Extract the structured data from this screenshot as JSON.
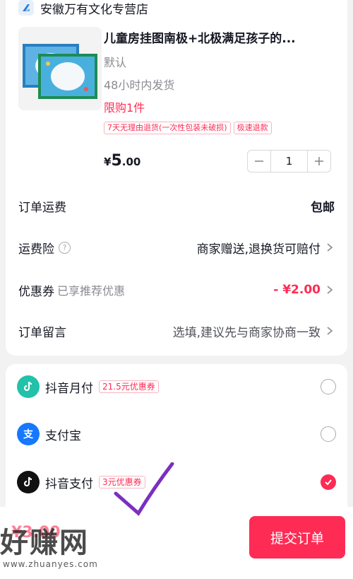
{
  "store": {
    "name": "安徽万有文化专营店",
    "logo_icon": "store-logo-icon"
  },
  "product": {
    "title": "儿童房挂图南极+北极满足孩子的...",
    "spec": "默认",
    "shipping": "48小时内发货",
    "limit": "限购1件",
    "tags": [
      "7天无理由退货(一次性包装未破损)",
      "极速退款"
    ],
    "price_currency": "¥",
    "price_int": "5",
    "price_dec": ".00",
    "quantity": "1",
    "minus_icon": "minus-icon",
    "plus_icon": "plus-icon"
  },
  "rows": {
    "freight_label": "订单运费",
    "freight_value": "包邮",
    "insurance_label": "运费险",
    "insurance_value": "商家赠送,退换货可赔付",
    "coupon_label": "优惠券",
    "coupon_sub": "已享推荐优惠",
    "coupon_value": "- ¥2.00",
    "note_label": "订单留言",
    "note_placeholder": "选填,建议先与商家协商一致"
  },
  "payment": {
    "methods": [
      {
        "label": "抖音月付",
        "tag": "21.5元优惠券",
        "icon": "douyin-monthly-icon",
        "checked": false
      },
      {
        "label": "支付宝",
        "tag": "",
        "icon": "alipay-icon",
        "checked": false
      },
      {
        "label": "抖音支付",
        "tag": "3元优惠券",
        "icon": "douyin-pay-icon",
        "checked": true
      }
    ]
  },
  "bottom": {
    "total": "¥3.00",
    "submit_label": "提交订单"
  },
  "watermark": {
    "logo": "好赚网",
    "url": "www.zhuanyes.com"
  },
  "colors": {
    "accent": "#fe2c55",
    "text": "#161823",
    "muted": "#8a8b91",
    "background": "#f2f2f2"
  }
}
